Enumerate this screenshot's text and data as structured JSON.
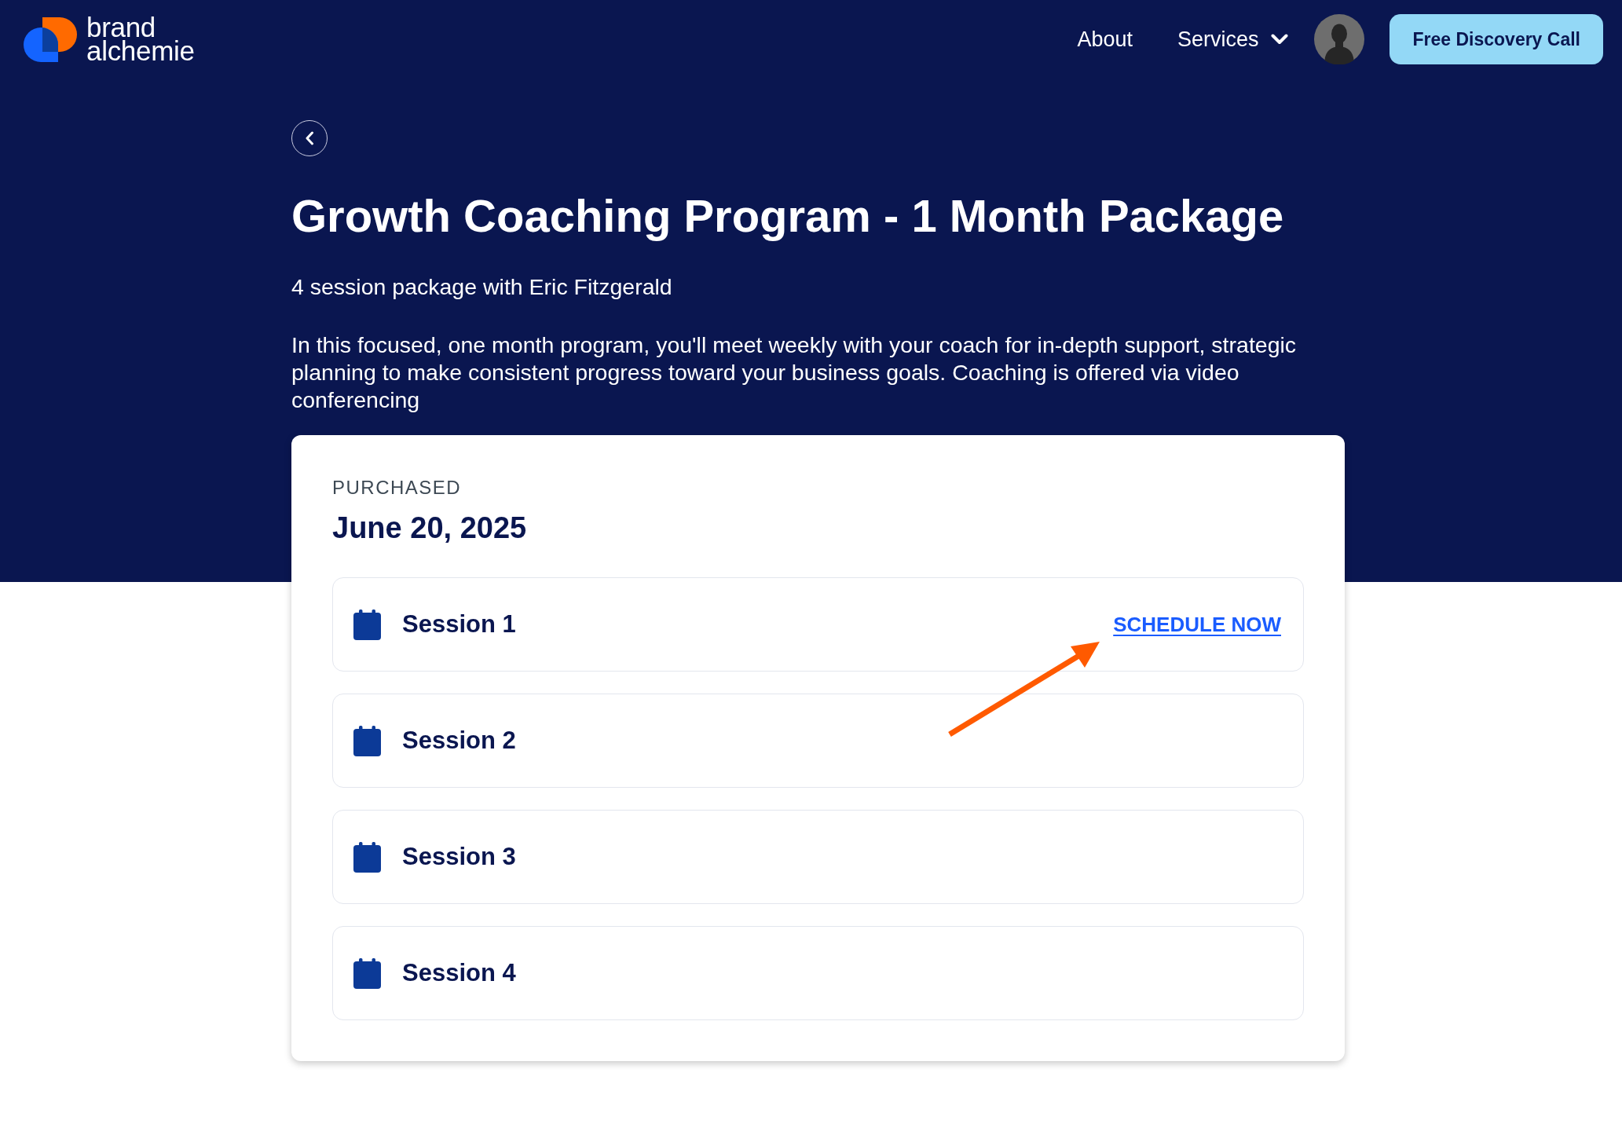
{
  "header": {
    "logo_lines": [
      "brand",
      "alchemie"
    ],
    "nav": [
      {
        "label": "About",
        "kind": "link"
      },
      {
        "label": "Services",
        "kind": "dropdown"
      }
    ],
    "cta": "Free Discovery Call"
  },
  "program": {
    "title": "Growth Coaching Program - 1 Month Package",
    "subtitle": "4 session package with Eric Fitzgerald",
    "description": "In this focused, one month program, you'll meet weekly with your coach for in-depth support, strategic planning to make consistent progress toward your business goals. Coaching is offered via video conferencing"
  },
  "purchase": {
    "label": "PURCHASED",
    "date": "June 20, 2025"
  },
  "sessions": [
    {
      "title": "Session 1",
      "action": "SCHEDULE NOW"
    },
    {
      "title": "Session 2"
    },
    {
      "title": "Session 3"
    },
    {
      "title": "Session 4"
    }
  ],
  "annotation": {
    "kind": "arrow"
  }
}
